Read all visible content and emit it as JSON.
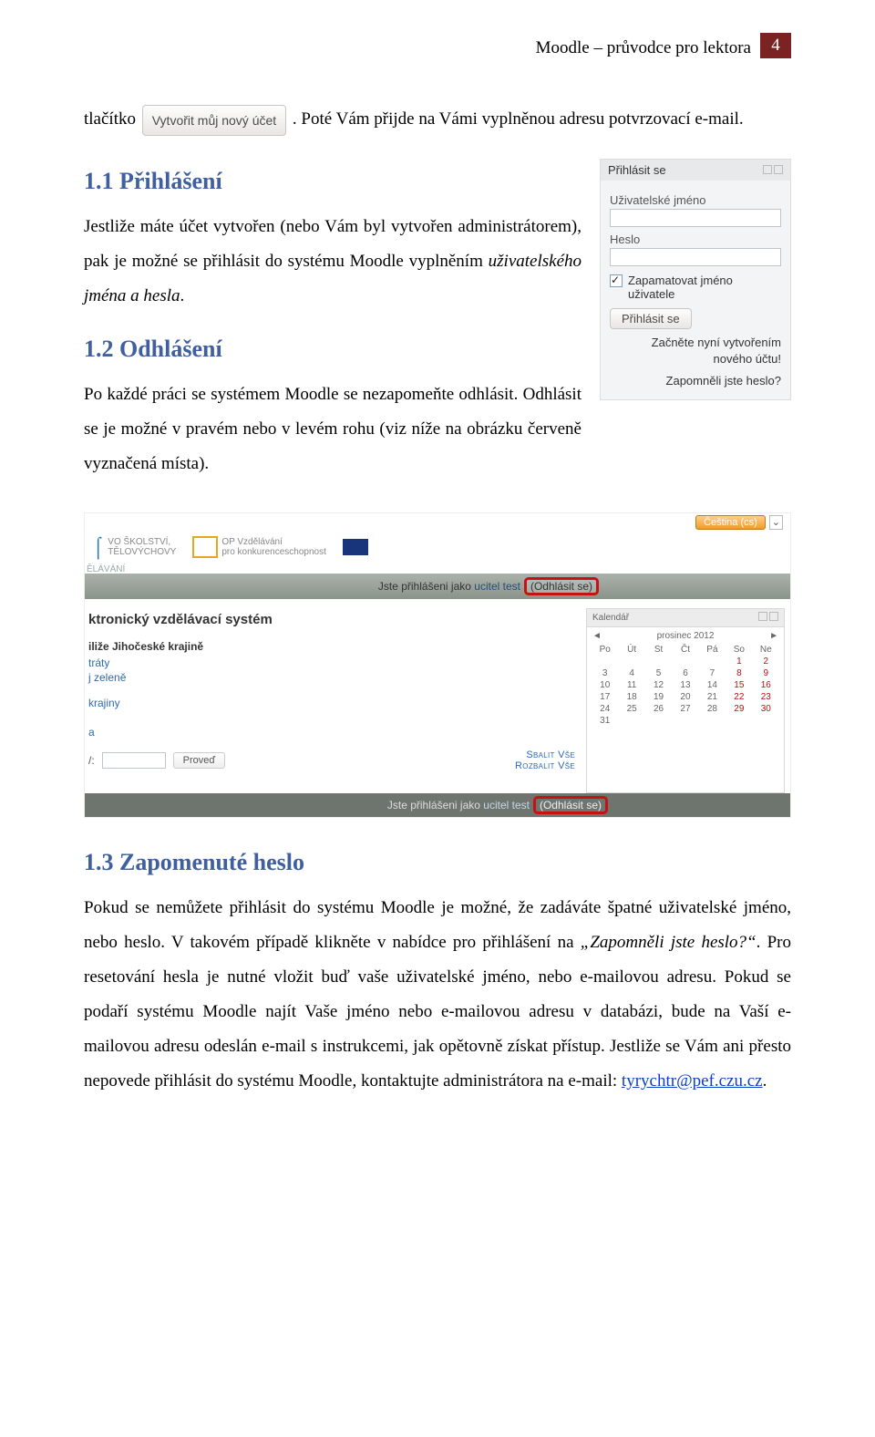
{
  "header": {
    "text": "Moodle – průvodce pro lektora",
    "page_number": "4"
  },
  "intro": {
    "prefix": "tlačítko ",
    "button": "Vytvořit můj nový účet",
    "suffix": ". Poté Vám přijde na Vámi vyplněnou adresu potvrzovací e-mail."
  },
  "sec11": {
    "title": "1.1  Přihlášení",
    "para": "Jestliže máte účet vytvořen (nebo Vám byl vytvořen administrátorem), pak je možné se přihlásit do systému Moodle vyplněním ",
    "para_em": "uživatelského jména a hesla",
    "para_end": "."
  },
  "login_block": {
    "title": "Přihlásit se",
    "lbl_user": "Uživatelské jméno",
    "lbl_pass": "Heslo",
    "chk_label": "Zapamatovat jméno uživatele",
    "btn": "Přihlásit se",
    "aux1": "Začněte nyní vytvořením nového účtu!",
    "aux2": "Zapomněli jste heslo?"
  },
  "sec12": {
    "title": "1.2  Odhlášení",
    "para": "Po každé práci se systémem Moodle se nezapomeňte odhlásit. Odhlásit se je možné v pravém nebo v levém rohu (viz níže na obrázku červeně vyznačená místa)."
  },
  "figure": {
    "lang_btn": "Čeština (cs)",
    "logo1": "VO ŠKOLSTVÍ,\nTĚLOVÝCHOVY",
    "logo2": "OP Vzdělávání\npro konkurenceschopnost",
    "sep": "ĚLÁVÁNÍ",
    "bar_msg": "Jste přihlášeni jako ",
    "bar_user": "ucitel test",
    "logout": "Odhlásit se",
    "left_title": "ktronický vzdělávací systém",
    "left_sub": "iliže Jihočeské krajině",
    "left_links": [
      "tráty",
      "j zeleně",
      "krajiny",
      "a",
      "/:"
    ],
    "proved": "Proveď",
    "sbalit": "Sbalit Vše",
    "rozbalit": "Rozbalit Vše",
    "cal_title": "Kalendář",
    "cal_month": "prosinec 2012",
    "cal_days": [
      "Po",
      "Út",
      "St",
      "Čt",
      "Pá",
      "So",
      "Ne"
    ],
    "cal_dates": [
      [
        "",
        "",
        "",
        "",
        "",
        "1",
        "2"
      ],
      [
        "3",
        "4",
        "5",
        "6",
        "7",
        "8",
        "9"
      ],
      [
        "10",
        "11",
        "12",
        "13",
        "14",
        "15",
        "16"
      ],
      [
        "17",
        "18",
        "19",
        "20",
        "21",
        "22",
        "23"
      ],
      [
        "24",
        "25",
        "26",
        "27",
        "28",
        "29",
        "30"
      ],
      [
        "31",
        "",
        "",
        "",
        "",
        "",
        ""
      ]
    ],
    "bar2_msg": "Jste přihlášeni jako ",
    "bar2_user": "ucitel test"
  },
  "sec13": {
    "title": "1.3  Zapomenuté heslo",
    "t1": "Pokud se nemůžete přihlásit do systému Moodle je možné, že zadáváte špatné uživatelské jméno, nebo heslo. V takovém případě klikněte v nabídce pro přihlášení na ",
    "t1_em": "„Zapomněli jste heslo?“",
    "t2": ". Pro resetování hesla je nutné vložit buď vaše uživatelské jméno, nebo e-mailovou adresu. Pokud se podaří systému Moodle najít Vaše jméno nebo e-mailovou adresu v databázi, bude na Vaší e-mailovou adresu odeslán e-mail s instrukcemi, jak opětovně získat přístup. Jestliže se Vám ani přesto nepovede přihlásit do systému Moodle, kontaktujte administrátora na e-mail: ",
    "email": "tyrychtr@pef.czu.cz",
    "t3": "."
  }
}
